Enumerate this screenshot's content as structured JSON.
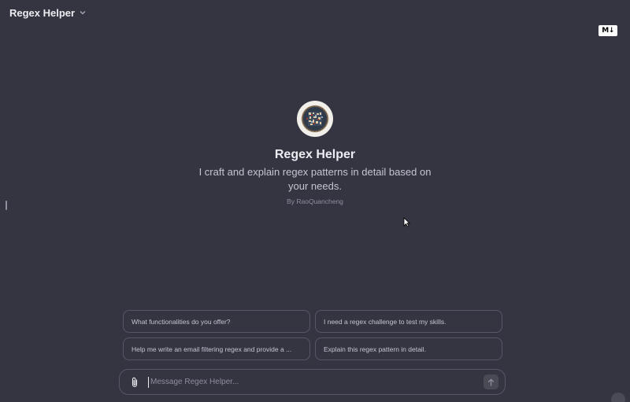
{
  "header": {
    "title": "Regex Helper",
    "menu_icon": "chevron-down-icon",
    "badge_text": "M↓"
  },
  "gpt": {
    "name": "Regex Helper",
    "description": "I craft and explain regex patterns in detail based on your needs.",
    "author": "By RaoQuancheng",
    "avatar_icon": "regex-helper-avatar"
  },
  "starters": [
    {
      "label": "What functionalities do you offer?"
    },
    {
      "label": "I need a regex challenge to test my skills."
    },
    {
      "label": "Help me write an email filtering regex and provide a ..."
    },
    {
      "label": "Explain this regex pattern in detail."
    }
  ],
  "composer": {
    "placeholder": "Message Regex Helper...",
    "attach_icon": "paperclip-icon",
    "send_icon": "arrow-up-icon"
  },
  "colors": {
    "background": "#343541",
    "border": "#565869",
    "text_primary": "#ececf1",
    "text_secondary": "#c5c5d2",
    "text_muted": "#8e8ea0"
  }
}
